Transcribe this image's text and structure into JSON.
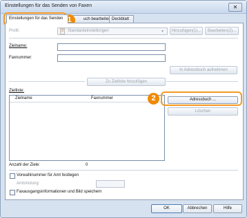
{
  "window": {
    "title": "Einstellungen für das Senden von Faxen",
    "close_label": "✕"
  },
  "tabs": [
    {
      "label": "Einstellungen für das Senden"
    },
    {
      "label": "uch bearbeiten"
    },
    {
      "label": "Deckblatt"
    }
  ],
  "profile": {
    "label": "Profil:",
    "value": "Standardeinstellungen",
    "add_button": "Hinzufügen(1)...",
    "edit_button": "Bearbeiten(2)..."
  },
  "fields": {
    "target_name_label": "Zielname:",
    "fax_number_label": "Faxnummer:",
    "add_to_addressbook_button": "In Adressbuch aufnehmen",
    "add_to_list_button": "Zu Zielliste hinzufügen"
  },
  "target_list": {
    "label": "Zielliste:",
    "columns": [
      "Zielname",
      "Faxnummer"
    ],
    "addressbook_button": "Adressbuch ...",
    "delete_button": "Löschen"
  },
  "count": {
    "label": "Anzahl der Ziele:",
    "value": "0"
  },
  "outside_line": {
    "checkbox_label": "Vorwahlnummer für Amt festlegen",
    "sub_label": "Amtsholung:"
  },
  "save_fax": {
    "checkbox_label": "Faxausgangsinformationen und Bild speichern"
  },
  "footer": {
    "ok": "OK",
    "cancel": "Abbrechen",
    "help": "Hilfe"
  },
  "callouts": [
    "1",
    "2"
  ],
  "colors": {
    "accent": "#f08a00",
    "window_bg": "#d7e2f0"
  }
}
